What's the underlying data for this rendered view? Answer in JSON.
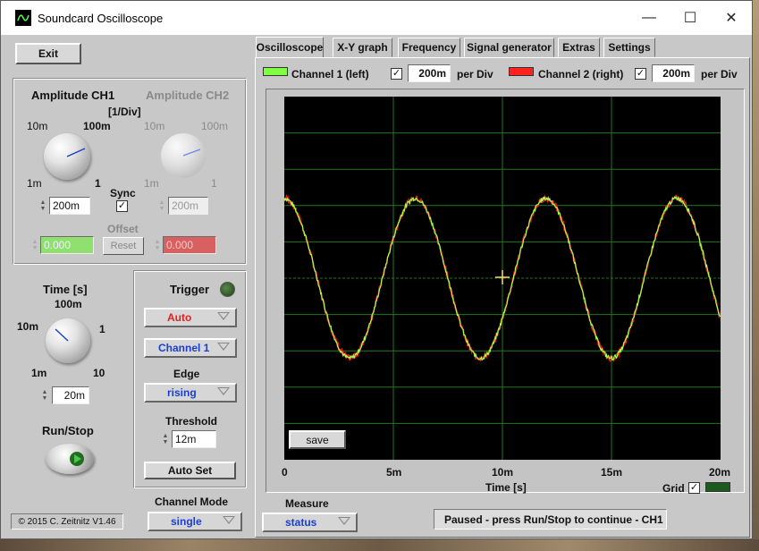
{
  "window": {
    "title": "Soundcard Oscilloscope",
    "controls": [
      "—",
      "☐",
      "✕"
    ]
  },
  "left": {
    "exit_label": "Exit",
    "amplitude_ch1": "Amplitude CH1",
    "amplitude_ch2": "Amplitude CH2",
    "div_label": "[1/Div]",
    "ch1_ticks": {
      "a": "10m",
      "b": "100m",
      "c": "1m",
      "d": "1"
    },
    "ch2_ticks": {
      "a": "10m",
      "b": "100m",
      "c": "1m",
      "d": "1"
    },
    "sync_label": "Sync",
    "sync_checked": true,
    "ch1_amp_value": "200m",
    "ch2_amp_value": "200m",
    "offset_label": "Offset",
    "reset_label": "Reset",
    "ch1_offset": "0.000",
    "ch2_offset": "0.000",
    "time_label": "Time [s]",
    "time_ticks": {
      "a": "100m",
      "b": "10m",
      "c": "1",
      "d": "1m",
      "e": "10"
    },
    "time_value": "20m",
    "runstop_label": "Run/Stop",
    "copyright": "© 2015  C. Zeitnitz V1.46",
    "channel_mode_label": "Channel Mode",
    "channel_mode_value": "single"
  },
  "trigger": {
    "title": "Trigger",
    "mode": "Auto",
    "channel": "Channel 1",
    "edge_label": "Edge",
    "edge": "rising",
    "threshold_label": "Threshold",
    "threshold": "12m",
    "auto_set_label": "Auto Set"
  },
  "tabs": [
    "Oscilloscope",
    "X-Y graph",
    "Frequency",
    "Signal generator",
    "Extras",
    "Settings"
  ],
  "channels": {
    "ch1_label": "Channel 1 (left)",
    "ch1_color": "#80ff40",
    "ch1_per_div": "200m",
    "ch2_label": "Channel 2 (right)",
    "ch2_color": "#ff2020",
    "ch2_per_div": "200m",
    "per_div_label": "per Div"
  },
  "plot": {
    "save_label": "save",
    "xticks": [
      "0",
      "5m",
      "10m",
      "15m",
      "20m"
    ],
    "xlabel": "Time [s]",
    "grid_label": "Grid",
    "grid_checked": true
  },
  "bottom": {
    "measure_label": "Measure",
    "measure_value": "status",
    "status_text": "Paused - press Run/Stop to continue - CH1"
  },
  "chart_data": {
    "type": "line",
    "xlim": [
      0,
      20
    ],
    "ylim": [
      -5,
      5
    ],
    "grid": true,
    "series": [
      {
        "color": "#a8ff50",
        "period": 6.0,
        "amplitude_div": 2.2,
        "offset_div": 0.0,
        "phase_start": 0.5
      }
    ]
  }
}
